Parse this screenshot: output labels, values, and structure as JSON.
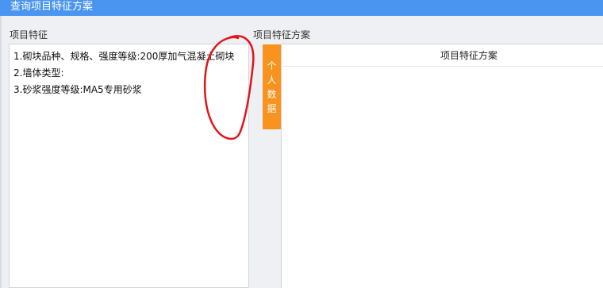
{
  "window": {
    "title": "查询项目特征方案"
  },
  "left": {
    "label": "项目特征",
    "lines": [
      "1.砌块品种、规格、强度等级:200厚加气混凝土砌块",
      "2.墙体类型:",
      "3.砂浆强度等级:MA5专用砂浆"
    ]
  },
  "right": {
    "label": "项目特征方案",
    "tab_chars": [
      "个",
      "人",
      "数",
      "据"
    ],
    "table_header": "项目特征方案"
  },
  "colors": {
    "titlebar": "#4a95f0",
    "tab": "#f7931e",
    "annotation": "#e0151b"
  }
}
